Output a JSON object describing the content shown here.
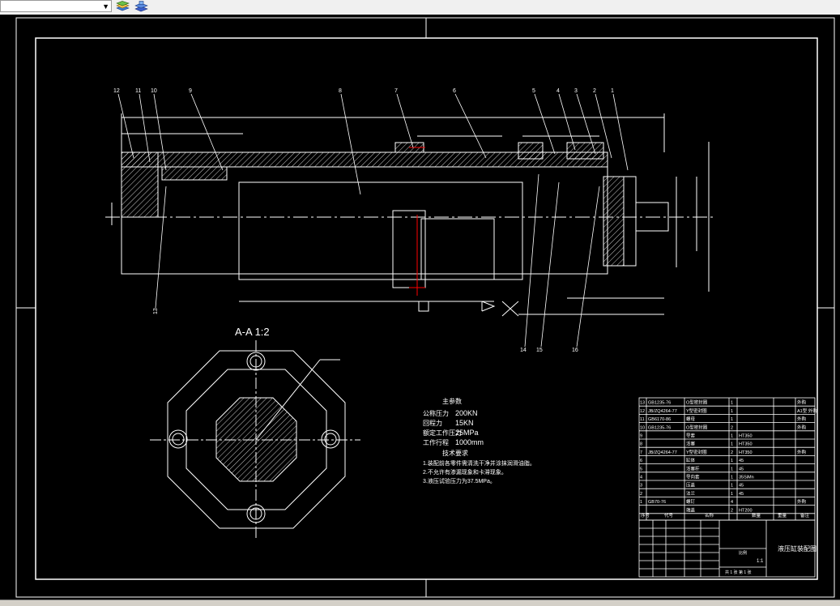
{
  "toolbar": {
    "layer_combo_value": "",
    "icons": [
      "layer-stack-icon",
      "layer-states-icon"
    ]
  },
  "drawing": {
    "colors": {
      "background": "#000000",
      "lines": "#ffffff",
      "hatch": "#ffffff",
      "accent": "#ff0000"
    },
    "balloons": [
      "12",
      "11",
      "10",
      "9",
      "8",
      "7",
      "6",
      "5",
      "4",
      "3",
      "2",
      "1",
      "13",
      "14",
      "15",
      "16"
    ],
    "section_label": "A-A 1:2",
    "notes": {
      "title": "主参数",
      "lines": [
        {
          "label": "公称压力",
          "value": "200KN"
        },
        {
          "label": "回程力",
          "value": "15KN"
        },
        {
          "label": "额定工作压力",
          "value": "25MPa"
        },
        {
          "label": "工作行程",
          "value": "1000mm"
        }
      ],
      "tech_title": "技术要求",
      "requirements": [
        "1.装配前各零件需清洗干净并涂抹润滑油脂。",
        "2.不允许有渗漏现象和卡滞现象。",
        "3.液压试验压力为37.5MPa。"
      ]
    },
    "bom": {
      "rows": [
        {
          "no": "13",
          "code": "GB1235-76",
          "name": "O型密封圈",
          "qty": "1",
          "material": "",
          "note": "外购"
        },
        {
          "no": "12",
          "code": "JB/ZQ4264-77",
          "name": "Y型密封圈",
          "qty": "1",
          "material": "",
          "note": "A1型 外购"
        },
        {
          "no": "11",
          "code": "GB6170-86",
          "name": "螺母",
          "qty": "1",
          "material": "",
          "note": "外购"
        },
        {
          "no": "10",
          "code": "GB1235-76",
          "name": "O型密封圈",
          "qty": "2",
          "material": "",
          "note": "外购"
        },
        {
          "no": "9",
          "code": "",
          "name": "导套",
          "qty": "1",
          "material": "HT350",
          "note": ""
        },
        {
          "no": "8",
          "code": "",
          "name": "活塞",
          "qty": "1",
          "material": "HT350",
          "note": ""
        },
        {
          "no": "7",
          "code": "JB/ZQ4264-77",
          "name": "Y型密封圈",
          "qty": "2",
          "material": "HT350",
          "note": "外购"
        },
        {
          "no": "6",
          "code": "",
          "name": "缸体",
          "qty": "1",
          "material": "45",
          "note": ""
        },
        {
          "no": "5",
          "code": "",
          "name": "活塞杆",
          "qty": "1",
          "material": "45",
          "note": ""
        },
        {
          "no": "4",
          "code": "",
          "name": "导向套",
          "qty": "1",
          "material": "35SiMn",
          "note": ""
        },
        {
          "no": "3",
          "code": "",
          "name": "压盖",
          "qty": "1",
          "material": "45",
          "note": ""
        },
        {
          "no": "2",
          "code": "",
          "name": "法兰",
          "qty": "1",
          "material": "45",
          "note": ""
        },
        {
          "no": "1",
          "code": "GB70-76",
          "name": "螺钉",
          "qty": "4",
          "material": "",
          "note": "外购"
        },
        {
          "no": "",
          "code": "",
          "name": "端盖",
          "qty": "2",
          "material": "HT200",
          "note": ""
        }
      ],
      "header": {
        "no": "序号",
        "code": "代号",
        "name": "名称",
        "qty": "数量",
        "material": "材料",
        "weight": "重量",
        "note": "备注"
      }
    },
    "title_block": {
      "drawing_name": "液压缸装配图",
      "scale_label": "比例",
      "scale": "1:1",
      "sheet": "共 1 张 第 1 张"
    }
  }
}
